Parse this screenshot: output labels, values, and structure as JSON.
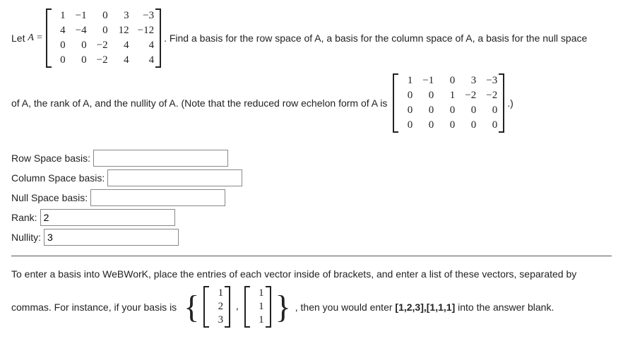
{
  "problem": {
    "let_prefix": "Let ",
    "A_eq": "A =",
    "matrixA": [
      [
        "1",
        "−1",
        "0",
        "3",
        "−3"
      ],
      [
        "4",
        "−4",
        "0",
        "12",
        "−12"
      ],
      [
        "0",
        "0",
        "−2",
        "4",
        "4"
      ],
      [
        "0",
        "0",
        "−2",
        "4",
        "4"
      ]
    ],
    "sentence1": ". Find a basis for the row space of A, a basis for the column space of A, a basis for the null space",
    "sentence2a": "of A, the rank of A, and the nullity of A. (Note that the reduced row echelon form of A is ",
    "rref": [
      [
        "1",
        "−1",
        "0",
        "3",
        "−3"
      ],
      [
        "0",
        "0",
        "1",
        "−2",
        "−2"
      ],
      [
        "0",
        "0",
        "0",
        "0",
        "0"
      ],
      [
        "0",
        "0",
        "0",
        "0",
        "0"
      ]
    ],
    "sentence2b": ".)"
  },
  "answers": {
    "row_label": "Row Space basis:",
    "row_value": "",
    "col_label": "Column Space basis:",
    "col_value": "",
    "null_label": "Null Space basis:",
    "null_value": "",
    "rank_label": "Rank:",
    "rank_value": "2",
    "nullity_label": "Nullity:",
    "nullity_value": "3"
  },
  "help": {
    "para1": "To enter a basis into WeBWorK, place the entries of each vector inside of brackets, and enter a list of these vectors, separated by",
    "para2a": "commas. For instance, if your basis is ",
    "vec1": [
      "1",
      "2",
      "3"
    ],
    "vec2": [
      "1",
      "1",
      "1"
    ],
    "para2b": ", then you would enter ",
    "bold_example": "[1,2,3],[1,1,1]",
    "para2c": " into the answer blank."
  }
}
